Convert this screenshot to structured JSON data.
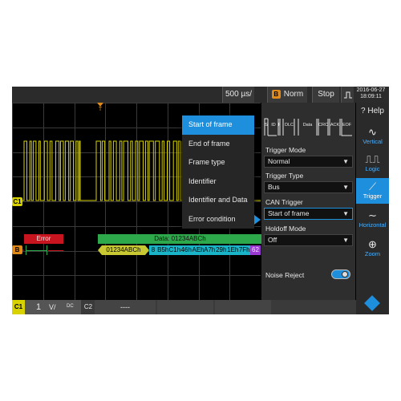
{
  "topbar": {
    "timebase": "500 µs/",
    "trigger_channel": "B",
    "trigger_mode": "Norm",
    "run_state": "Stop",
    "date": "2016-06-27",
    "time": "18:09:11"
  },
  "markers": {
    "trigger": "T",
    "c1": "C1",
    "b": "B"
  },
  "bus": {
    "error": "Error",
    "data_header": "Data: 01234ABCh",
    "id_value": "01234ABCh",
    "dlc": "8",
    "bytes": [
      "B5h",
      "C1h",
      "46h",
      "AEh",
      "A7h",
      "29h",
      "1Eh",
      "7Fh"
    ],
    "crc": "62"
  },
  "dropdown": {
    "items": [
      "Start of frame",
      "End of frame",
      "Frame type",
      "Identifier",
      "Identifier and Data",
      "Error condition"
    ],
    "selected_index": 0
  },
  "frame_diagram": {
    "fields": [
      "S",
      "ID",
      "R",
      "DLC",
      "Data",
      "CRC",
      "ACK",
      "EOF"
    ]
  },
  "panel": {
    "trigger_mode_label": "Trigger Mode",
    "trigger_mode_value": "Normal",
    "trigger_type_label": "Trigger Type",
    "trigger_type_value": "Bus",
    "can_trigger_label": "CAN Trigger",
    "can_trigger_value": "Start of frame",
    "holdoff_label": "Holdoff Mode",
    "holdoff_value": "Off",
    "noise_reject_label": "Noise Reject",
    "noise_reject_on": true
  },
  "sidebar": {
    "help": "Help",
    "vertical": "Vertical",
    "logic": "Logic",
    "trigger": "Trigger",
    "horizontal": "Horizontal",
    "zoom": "Zoom"
  },
  "bottombar": {
    "c1_label": "C1",
    "c1_scale": "1",
    "c1_unit": "V/",
    "c1_coupling": "DC",
    "c2_label": "C2",
    "c2_value": "----"
  },
  "colors": {
    "waveform": "#d8d200",
    "accent": "#1e8fdc",
    "error": "#c8141e",
    "bus_data": "#2da84a",
    "bus_id": "#c8c832",
    "bus_byte": "#1ab4c8",
    "trigger_marker": "#e08a1a"
  }
}
